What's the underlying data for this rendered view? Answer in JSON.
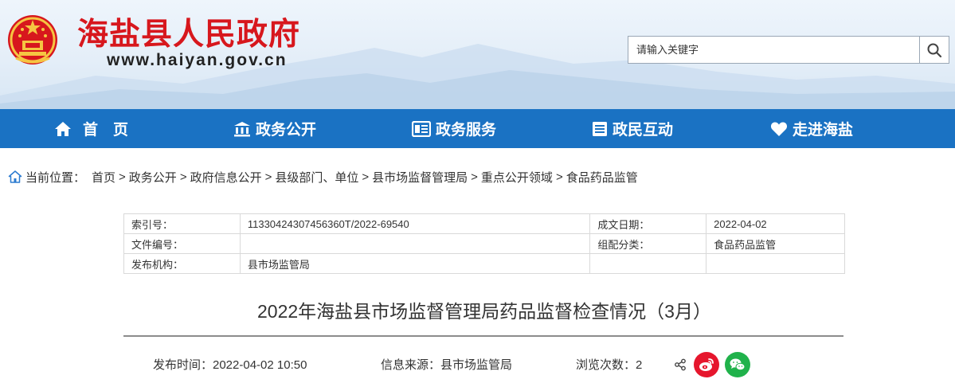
{
  "header": {
    "site_name": "海盐县人民政府",
    "site_url": "www.haiyan.gov.cn",
    "search_placeholder": "请输入关键字"
  },
  "nav": {
    "items": [
      {
        "label": "首　页",
        "icon": "home-icon"
      },
      {
        "label": "政务公开",
        "icon": "building-icon"
      },
      {
        "label": "政务服务",
        "icon": "service-icon"
      },
      {
        "label": "政民互动",
        "icon": "interaction-icon"
      },
      {
        "label": "走进海盐",
        "icon": "heart-icon"
      }
    ]
  },
  "breadcrumb": {
    "prefix": "当前位置：",
    "items": [
      "首页",
      "政务公开",
      "政府信息公开",
      "县级部门、单位",
      "县市场监督管理局",
      "重点公开领域",
      "食品药品监管"
    ],
    "separator": ">"
  },
  "meta": {
    "index_label": "索引号：",
    "index_value": "11330424307456360T/2022-69540",
    "date_label": "成文日期：",
    "date_value": "2022-04-02",
    "doc_no_label": "文件编号：",
    "doc_no_value": "",
    "category_label": "组配分类：",
    "category_value": "食品药品监管",
    "publisher_label": "发布机构：",
    "publisher_value": "县市场监管局"
  },
  "article": {
    "title": "2022年海盐县市场监督管理局药品监督检查情况（3月）",
    "publish_time": "发布时间：2022-04-02 10:50",
    "source": "信息来源：县市场监管局",
    "views": "浏览次数：2"
  },
  "colors": {
    "brand_red": "#d7171d",
    "nav_blue": "#1a72c3",
    "weibo_red": "#e6162d",
    "wechat_green": "#20b24b"
  }
}
